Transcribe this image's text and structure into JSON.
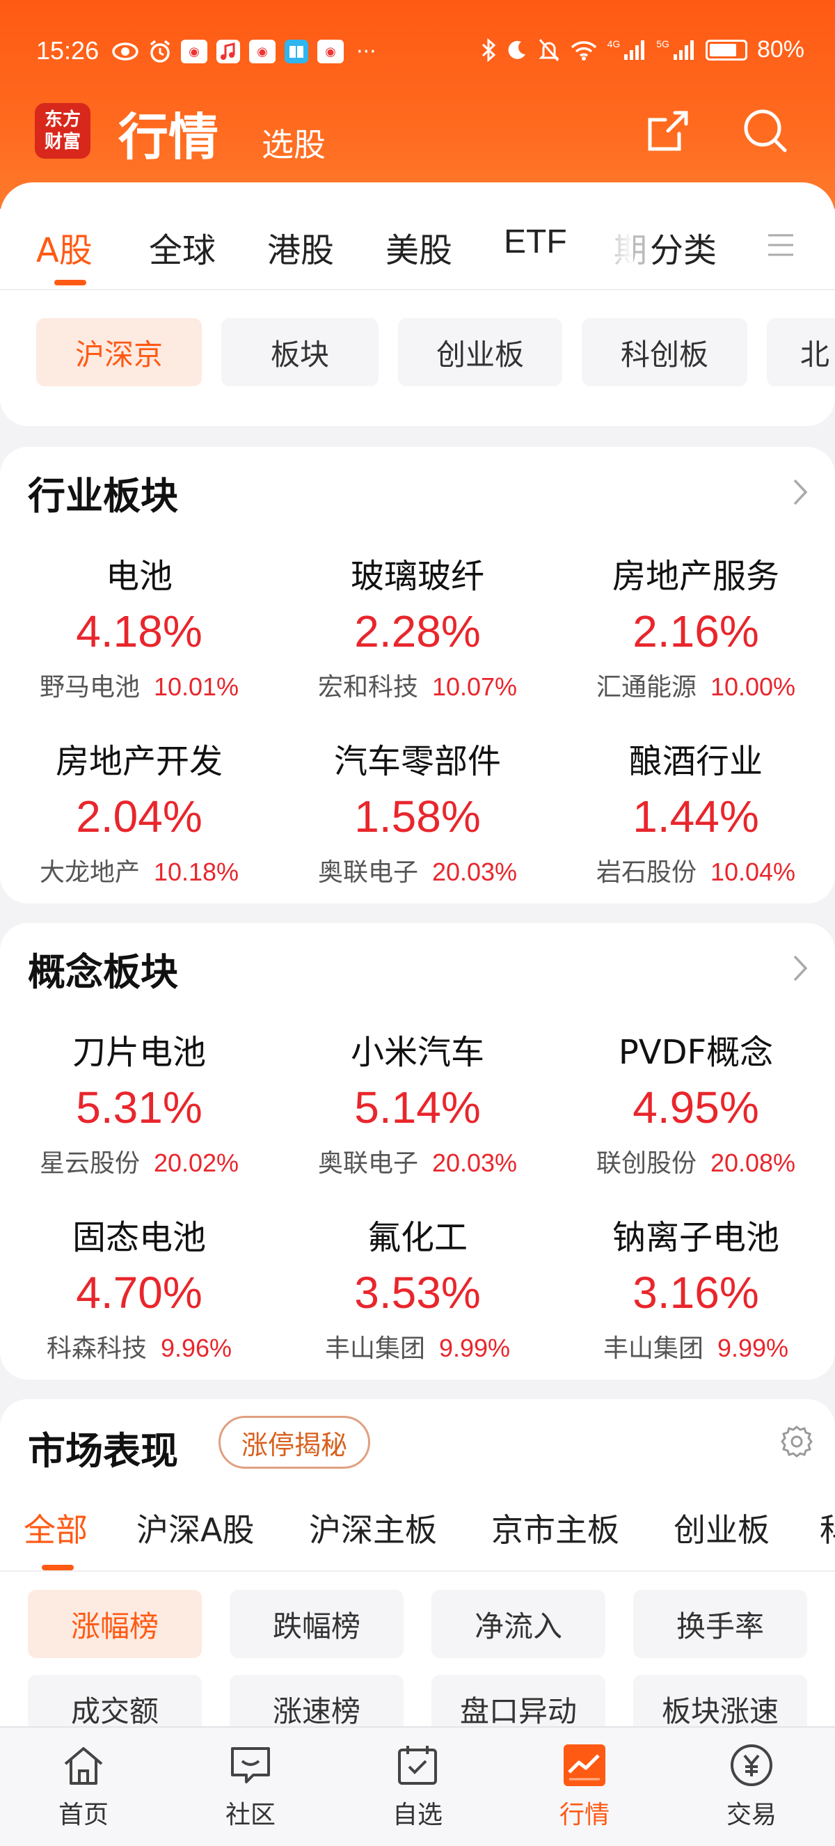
{
  "status_bar": {
    "time": "15:26",
    "battery": "80%",
    "network_4g": "4G",
    "network_5g": "5G",
    "battery_level": 0.8,
    "more": "···"
  },
  "header": {
    "logo_text": "东方财富",
    "title": "行情",
    "subtitle": "选股"
  },
  "market_tabs": [
    "A股",
    "全球",
    "港股",
    "美股",
    "ETF",
    "期",
    "分类"
  ],
  "sub_chips": [
    "沪深京",
    "板块",
    "创业板",
    "科创板",
    "北"
  ],
  "industry": {
    "title": "行业板块",
    "items": [
      {
        "name": "电池",
        "pct": "4.18%",
        "stock": "野马电池",
        "stock_pct": "10.01%"
      },
      {
        "name": "玻璃玻纤",
        "pct": "2.28%",
        "stock": "宏和科技",
        "stock_pct": "10.07%"
      },
      {
        "name": "房地产服务",
        "pct": "2.16%",
        "stock": "汇通能源",
        "stock_pct": "10.00%"
      },
      {
        "name": "房地产开发",
        "pct": "2.04%",
        "stock": "大龙地产",
        "stock_pct": "10.18%"
      },
      {
        "name": "汽车零部件",
        "pct": "1.58%",
        "stock": "奥联电子",
        "stock_pct": "20.03%"
      },
      {
        "name": "酿酒行业",
        "pct": "1.44%",
        "stock": "岩石股份",
        "stock_pct": "10.04%"
      }
    ]
  },
  "concept": {
    "title": "概念板块",
    "items": [
      {
        "name": "刀片电池",
        "pct": "5.31%",
        "stock": "星云股份",
        "stock_pct": "20.02%"
      },
      {
        "name": "小米汽车",
        "pct": "5.14%",
        "stock": "奥联电子",
        "stock_pct": "20.03%"
      },
      {
        "name": "PVDF概念",
        "pct": "4.95%",
        "stock": "联创股份",
        "stock_pct": "20.08%"
      },
      {
        "name": "固态电池",
        "pct": "4.70%",
        "stock": "科森科技",
        "stock_pct": "9.96%"
      },
      {
        "name": "氟化工",
        "pct": "3.53%",
        "stock": "丰山集团",
        "stock_pct": "9.99%"
      },
      {
        "name": "钠离子电池",
        "pct": "3.16%",
        "stock": "丰山集团",
        "stock_pct": "9.99%"
      }
    ]
  },
  "market": {
    "title": "市场表现",
    "pill": "涨停揭秘",
    "tabs": [
      "全部",
      "沪深A股",
      "沪深主板",
      "京市主板",
      "创业板",
      "科"
    ],
    "rank_chips": [
      "涨幅榜",
      "跌幅榜",
      "净流入",
      "换手率",
      "成交额",
      "涨速榜",
      "盘口异动",
      "板块涨速"
    ]
  },
  "bottom_nav": [
    "首页",
    "社区",
    "自选",
    "行情",
    "交易"
  ],
  "colors": {
    "accent": "#ff5a14",
    "up": "#e8262c"
  }
}
